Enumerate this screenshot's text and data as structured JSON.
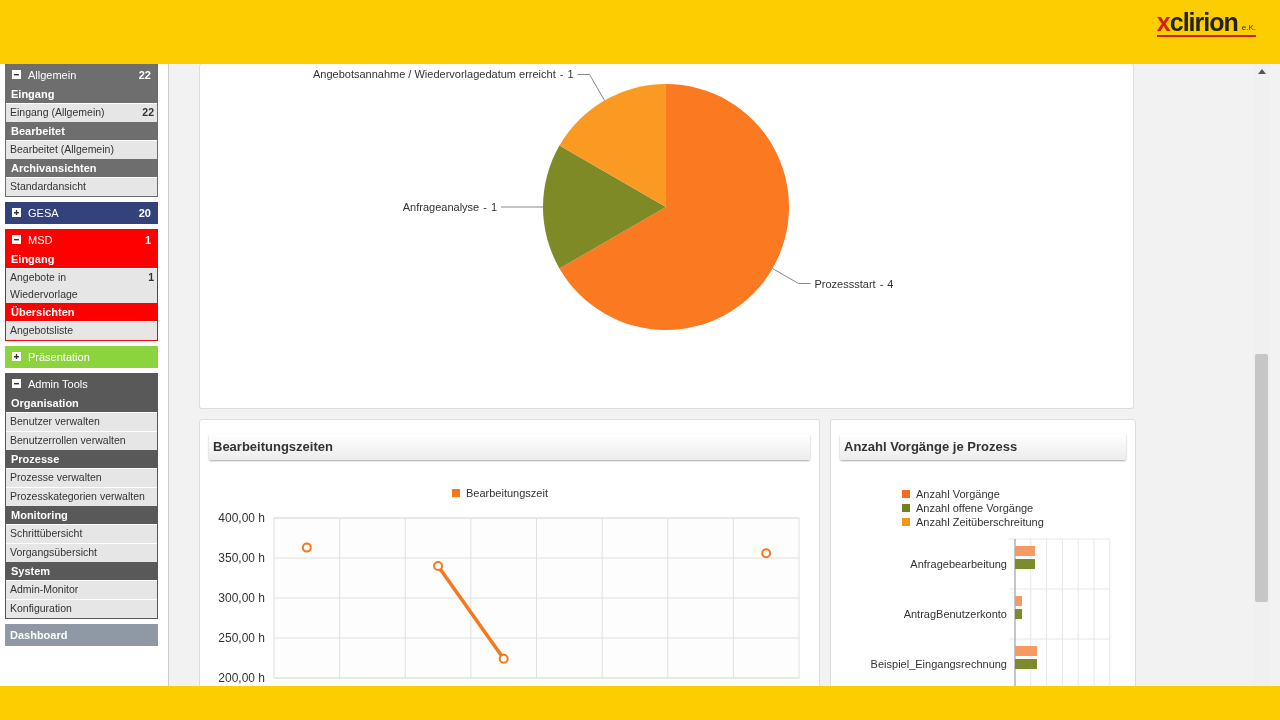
{
  "header": {
    "logo": {
      "mark": "x",
      "name": "clirion",
      "suffix": "e.K."
    }
  },
  "sidebar": {
    "groups": [
      {
        "title": "Allgemein",
        "count": "22",
        "expanded": true,
        "color": "#6e6e6e",
        "sections": [
          {
            "title": "Eingang",
            "items": [
              {
                "label": "Eingang (Allgemein)",
                "count": "22"
              }
            ]
          },
          {
            "title": "Bearbeitet",
            "items": [
              {
                "label": "Bearbeitet (Allgemein)"
              }
            ]
          },
          {
            "title": "Archivansichten",
            "items": [
              {
                "label": "Standardansicht"
              }
            ]
          }
        ]
      },
      {
        "title": "GESA",
        "count": "20",
        "expanded": false,
        "color": "#33427a"
      },
      {
        "title": "MSD",
        "count": "1",
        "expanded": true,
        "color": "#ff0000",
        "sections": [
          {
            "title": "Eingang",
            "items": [
              {
                "label": "Angebote in Wiedervorlage",
                "count": "1"
              }
            ]
          },
          {
            "title": "Übersichten",
            "items": [
              {
                "label": "Angebotsliste"
              }
            ]
          }
        ]
      },
      {
        "title": "Präsentation",
        "expanded": false,
        "color": "#8cd43e"
      },
      {
        "title": "Admin Tools",
        "expanded": true,
        "color": "#595959",
        "sections": [
          {
            "title": "Organisation",
            "items": [
              {
                "label": "Benutzer verwalten"
              },
              {
                "label": "Benutzerrollen verwalten"
              }
            ]
          },
          {
            "title": "Prozesse",
            "items": [
              {
                "label": "Prozesse verwalten"
              },
              {
                "label": "Prozesskategorien verwalten"
              }
            ]
          },
          {
            "title": "Monitoring",
            "items": [
              {
                "label": "Schrittübersicht"
              },
              {
                "label": "Vorgangsübersicht"
              }
            ]
          },
          {
            "title": "System",
            "items": [
              {
                "label": "Admin-Monitor"
              },
              {
                "label": "Konfiguration"
              }
            ]
          }
        ]
      },
      {
        "title": "Dashboard",
        "color": "#8e99a5"
      }
    ]
  },
  "dashboard": {
    "pie_panel": {
      "label_separator": "-",
      "chart_data": {
        "type": "pie",
        "categories": [
          "Prozessstart",
          "Anfrageanalyse",
          "Angebotsannahme / Wiedervorlagedatum erreicht"
        ],
        "values": [
          4,
          1,
          1
        ],
        "colors": [
          "#fb7a21",
          "#7d8a26",
          "#fa9a22"
        ],
        "data_labels": true
      }
    },
    "panels": [
      {
        "kind": "line",
        "title": "Bearbeitungszeiten",
        "chart_data": {
          "type": "line",
          "grid": true,
          "ylim": [
            200,
            400
          ],
          "yticks": [
            {
              "value": 200,
              "label": "200,00 h"
            },
            {
              "value": 250,
              "label": "250,00 h"
            },
            {
              "value": 300,
              "label": "300,00 h"
            },
            {
              "value": 350,
              "label": "350,00 h"
            },
            {
              "value": 400,
              "label": "400,00 h"
            }
          ],
          "series": [
            {
              "name": "Bearbeitungszeit",
              "color": "#f5781f",
              "marker": "circle",
              "values": [
                363,
                null,
                340,
                224,
                null,
                null,
                null,
                356
              ]
            }
          ]
        }
      },
      {
        "kind": "bars",
        "title": "Anzahl Vorgänge je Prozess",
        "legend": [
          {
            "label": "Anzahl Vorgänge",
            "color": "#f26d21"
          },
          {
            "label": "Anzahl offene Vorgänge",
            "color": "#727f24"
          },
          {
            "label": "Anzahl Zeitüberschreitung",
            "color": "#f7941e"
          }
        ],
        "categories": [
          "Anfragebearbeitung",
          "AntragBenutzerkonto",
          "Beispiel_Eingangsrechnung"
        ]
      }
    ]
  }
}
